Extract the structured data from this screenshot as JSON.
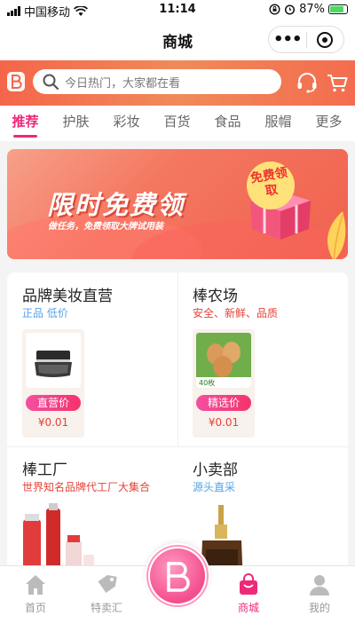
{
  "status_bar": {
    "carrier": "中国移动",
    "time": "11:14",
    "battery": "87%"
  },
  "navbar": {
    "title": "商城",
    "more_label": "•••"
  },
  "search": {
    "placeholder": "今日热门，大家都在看"
  },
  "tabs": [
    {
      "label": "推荐",
      "active": true
    },
    {
      "label": "护肤"
    },
    {
      "label": "彩妆"
    },
    {
      "label": "百货"
    },
    {
      "label": "食品"
    },
    {
      "label": "服帽"
    },
    {
      "label": "更多"
    }
  ],
  "banner": {
    "title": "限时免费领",
    "subtitle": "做任务，免费领取大牌试用装",
    "badge": "免费领取"
  },
  "sections": [
    {
      "title": "品牌美妆直营",
      "subtitle": "正品 低价",
      "product": {
        "tag": "直营价",
        "price": "¥0.01"
      }
    },
    {
      "title": "棒农场",
      "subtitle": "安全、新鲜、品质",
      "product": {
        "tag": "精选价",
        "price": "¥0.01",
        "img_text": "40枚"
      }
    },
    {
      "title": "棒工厂",
      "subtitle": "世界知名品牌代工厂大集合"
    },
    {
      "title": "小卖部",
      "subtitle": "源头直采"
    }
  ],
  "tabbar": {
    "items": [
      {
        "label": "首页"
      },
      {
        "label": "特卖汇"
      },
      {
        "label": "商城",
        "active": true
      },
      {
        "label": "我的"
      }
    ]
  },
  "colors": {
    "accent": "#f0287a",
    "header": "#f5654a",
    "price": "#e3433a",
    "subtitle_blue": "#57a3e5"
  }
}
